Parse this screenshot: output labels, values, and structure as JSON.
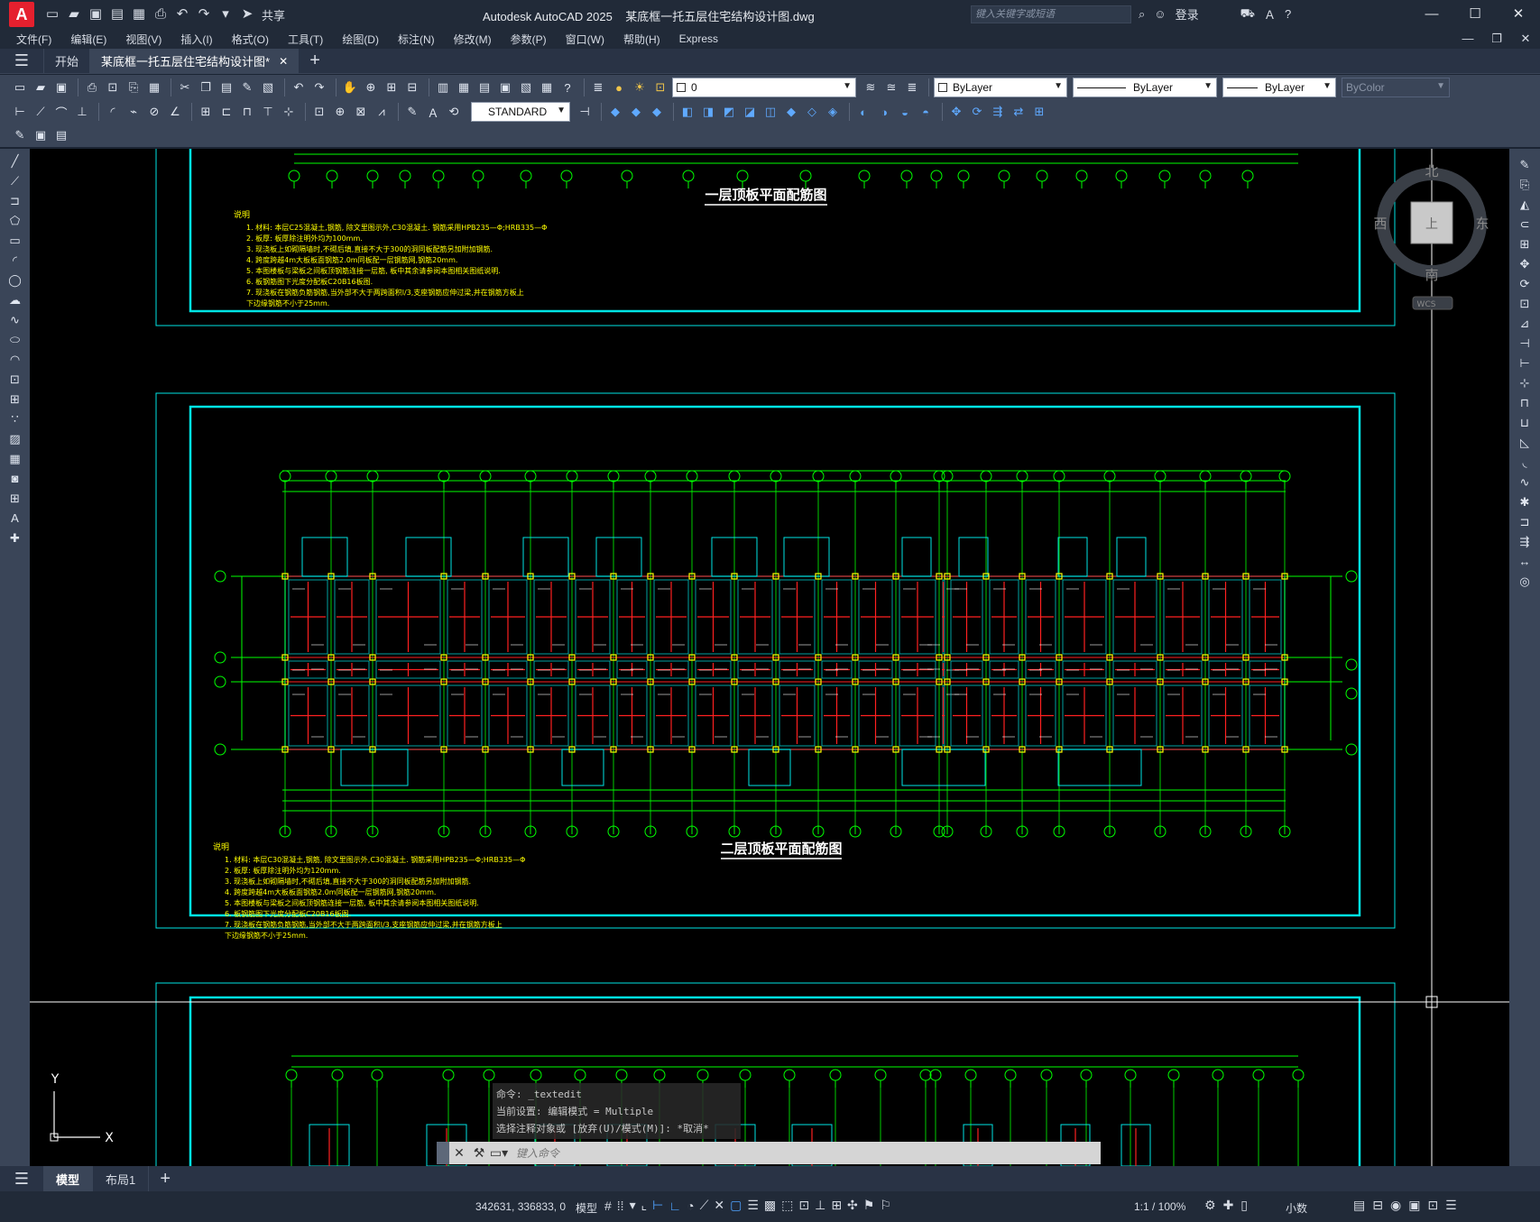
{
  "window": {
    "app_title": "Autodesk AutoCAD 2025",
    "file_title": "某底框一托五层住宅结构设计图.dwg",
    "search_placeholder": "键入关键字或短语",
    "login": "登录",
    "share": "共享"
  },
  "menu": [
    "文件(F)",
    "编辑(E)",
    "视图(V)",
    "插入(I)",
    "格式(O)",
    "工具(T)",
    "绘图(D)",
    "标注(N)",
    "修改(M)",
    "参数(P)",
    "窗口(W)",
    "帮助(H)",
    "Express"
  ],
  "tabs": {
    "start": "开始",
    "doc": "某底框一托五层住宅结构设计图*"
  },
  "properties": {
    "layer": "0",
    "text_style": "STANDARD",
    "color": "ByLayer",
    "linetype": "ByLayer",
    "lineweight": "ByLayer",
    "plotstyle": "ByColor"
  },
  "viewcube": {
    "north": "北",
    "south": "南",
    "east": "东",
    "west": "西",
    "face": "上",
    "wcs": "WCS"
  },
  "drawing": {
    "title1": "一层顶板平面配筋图",
    "title2": "二层顶板平面配筋图",
    "notes_heading": "说明",
    "notes1": [
      "1. 材料: 本层C25混凝土,钢筋, 除文里图示外,C30混凝土. 钢筋采用HPB235—Φ;HRB335—Φ",
      "2. 板厚: 板厚除注明外均为100mm.",
      "3. 现浇板上如砌隔墙时,不砌后填,直接不大于300的洞同板配筋另加附加钢筋.",
      "4. 跨度跨越4m大板板面钢筋2.0m同板配一层钢筋网,钢筋20mm.",
      "5. 本图楼板与梁板之间板顶钢筋连接一层筋, 板中其余请参阅本图相关图纸说明.",
      "6. 板钢筋图下光度分配板C20B16板图.",
      "7. 现浇板在钢筋负筋钢筋,当外部不大于两跨面积l/3,支座钢筋应伸过梁,并在钢筋方板上",
      "    下边缘钢筋不小于25mm."
    ],
    "notes2": [
      "1. 材料: 本层C30混凝土,钢筋, 除文里图示外,C30混凝土. 钢筋采用HPB235—Φ;HRB335—Φ",
      "2. 板厚: 板厚除注明外均为120mm.",
      "3. 现浇板上如砌隔墙时,不砌后填,直接不大于300的洞同板配筋另加附加钢筋.",
      "4. 跨度跨越4m大板板面钢筋2.0m同板配一层钢筋网,钢筋20mm.",
      "5. 本图楼板与梁板之间板顶钢筋连接一层筋, 板中其余请参阅本图相关图纸说明.",
      "6. 板钢筋图下光度分配板C20B16板图.",
      "7. 现浇板在钢筋负筋钢筋,当外部不大于两跨面积l/3,支座钢筋应伸过梁,并在钢筋方板上",
      "    下边缘钢筋不小于25mm."
    ],
    "ucs": {
      "x": "X",
      "y": "Y"
    }
  },
  "command": {
    "history": [
      "命令:  _textedit",
      "当前设置: 编辑模式 = Multiple",
      "选择注释对象或 [放弃(U)/模式(M)]: *取消*"
    ],
    "placeholder": "键入命令"
  },
  "layouts": {
    "model": "模型",
    "layout1": "布局1"
  },
  "status": {
    "coords": "342631, 336833, 0",
    "mode": "模型",
    "scale": "1:1 / 100%",
    "units": "小数"
  }
}
